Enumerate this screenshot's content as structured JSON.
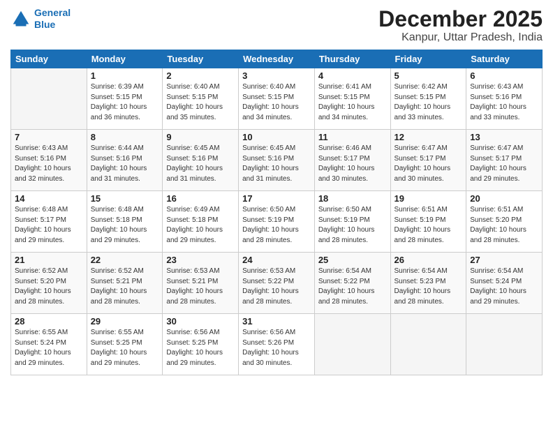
{
  "logo": {
    "line1": "General",
    "line2": "Blue"
  },
  "header": {
    "month": "December 2025",
    "location": "Kanpur, Uttar Pradesh, India"
  },
  "weekdays": [
    "Sunday",
    "Monday",
    "Tuesday",
    "Wednesday",
    "Thursday",
    "Friday",
    "Saturday"
  ],
  "weeks": [
    [
      {
        "day": "",
        "sunrise": "",
        "sunset": "",
        "daylight": ""
      },
      {
        "day": "1",
        "sunrise": "Sunrise: 6:39 AM",
        "sunset": "Sunset: 5:15 PM",
        "daylight": "Daylight: 10 hours and 36 minutes."
      },
      {
        "day": "2",
        "sunrise": "Sunrise: 6:40 AM",
        "sunset": "Sunset: 5:15 PM",
        "daylight": "Daylight: 10 hours and 35 minutes."
      },
      {
        "day": "3",
        "sunrise": "Sunrise: 6:40 AM",
        "sunset": "Sunset: 5:15 PM",
        "daylight": "Daylight: 10 hours and 34 minutes."
      },
      {
        "day": "4",
        "sunrise": "Sunrise: 6:41 AM",
        "sunset": "Sunset: 5:15 PM",
        "daylight": "Daylight: 10 hours and 34 minutes."
      },
      {
        "day": "5",
        "sunrise": "Sunrise: 6:42 AM",
        "sunset": "Sunset: 5:15 PM",
        "daylight": "Daylight: 10 hours and 33 minutes."
      },
      {
        "day": "6",
        "sunrise": "Sunrise: 6:43 AM",
        "sunset": "Sunset: 5:16 PM",
        "daylight": "Daylight: 10 hours and 33 minutes."
      }
    ],
    [
      {
        "day": "7",
        "sunrise": "Sunrise: 6:43 AM",
        "sunset": "Sunset: 5:16 PM",
        "daylight": "Daylight: 10 hours and 32 minutes."
      },
      {
        "day": "8",
        "sunrise": "Sunrise: 6:44 AM",
        "sunset": "Sunset: 5:16 PM",
        "daylight": "Daylight: 10 hours and 31 minutes."
      },
      {
        "day": "9",
        "sunrise": "Sunrise: 6:45 AM",
        "sunset": "Sunset: 5:16 PM",
        "daylight": "Daylight: 10 hours and 31 minutes."
      },
      {
        "day": "10",
        "sunrise": "Sunrise: 6:45 AM",
        "sunset": "Sunset: 5:16 PM",
        "daylight": "Daylight: 10 hours and 31 minutes."
      },
      {
        "day": "11",
        "sunrise": "Sunrise: 6:46 AM",
        "sunset": "Sunset: 5:17 PM",
        "daylight": "Daylight: 10 hours and 30 minutes."
      },
      {
        "day": "12",
        "sunrise": "Sunrise: 6:47 AM",
        "sunset": "Sunset: 5:17 PM",
        "daylight": "Daylight: 10 hours and 30 minutes."
      },
      {
        "day": "13",
        "sunrise": "Sunrise: 6:47 AM",
        "sunset": "Sunset: 5:17 PM",
        "daylight": "Daylight: 10 hours and 29 minutes."
      }
    ],
    [
      {
        "day": "14",
        "sunrise": "Sunrise: 6:48 AM",
        "sunset": "Sunset: 5:17 PM",
        "daylight": "Daylight: 10 hours and 29 minutes."
      },
      {
        "day": "15",
        "sunrise": "Sunrise: 6:48 AM",
        "sunset": "Sunset: 5:18 PM",
        "daylight": "Daylight: 10 hours and 29 minutes."
      },
      {
        "day": "16",
        "sunrise": "Sunrise: 6:49 AM",
        "sunset": "Sunset: 5:18 PM",
        "daylight": "Daylight: 10 hours and 29 minutes."
      },
      {
        "day": "17",
        "sunrise": "Sunrise: 6:50 AM",
        "sunset": "Sunset: 5:19 PM",
        "daylight": "Daylight: 10 hours and 28 minutes."
      },
      {
        "day": "18",
        "sunrise": "Sunrise: 6:50 AM",
        "sunset": "Sunset: 5:19 PM",
        "daylight": "Daylight: 10 hours and 28 minutes."
      },
      {
        "day": "19",
        "sunrise": "Sunrise: 6:51 AM",
        "sunset": "Sunset: 5:19 PM",
        "daylight": "Daylight: 10 hours and 28 minutes."
      },
      {
        "day": "20",
        "sunrise": "Sunrise: 6:51 AM",
        "sunset": "Sunset: 5:20 PM",
        "daylight": "Daylight: 10 hours and 28 minutes."
      }
    ],
    [
      {
        "day": "21",
        "sunrise": "Sunrise: 6:52 AM",
        "sunset": "Sunset: 5:20 PM",
        "daylight": "Daylight: 10 hours and 28 minutes."
      },
      {
        "day": "22",
        "sunrise": "Sunrise: 6:52 AM",
        "sunset": "Sunset: 5:21 PM",
        "daylight": "Daylight: 10 hours and 28 minutes."
      },
      {
        "day": "23",
        "sunrise": "Sunrise: 6:53 AM",
        "sunset": "Sunset: 5:21 PM",
        "daylight": "Daylight: 10 hours and 28 minutes."
      },
      {
        "day": "24",
        "sunrise": "Sunrise: 6:53 AM",
        "sunset": "Sunset: 5:22 PM",
        "daylight": "Daylight: 10 hours and 28 minutes."
      },
      {
        "day": "25",
        "sunrise": "Sunrise: 6:54 AM",
        "sunset": "Sunset: 5:22 PM",
        "daylight": "Daylight: 10 hours and 28 minutes."
      },
      {
        "day": "26",
        "sunrise": "Sunrise: 6:54 AM",
        "sunset": "Sunset: 5:23 PM",
        "daylight": "Daylight: 10 hours and 28 minutes."
      },
      {
        "day": "27",
        "sunrise": "Sunrise: 6:54 AM",
        "sunset": "Sunset: 5:24 PM",
        "daylight": "Daylight: 10 hours and 29 minutes."
      }
    ],
    [
      {
        "day": "28",
        "sunrise": "Sunrise: 6:55 AM",
        "sunset": "Sunset: 5:24 PM",
        "daylight": "Daylight: 10 hours and 29 minutes."
      },
      {
        "day": "29",
        "sunrise": "Sunrise: 6:55 AM",
        "sunset": "Sunset: 5:25 PM",
        "daylight": "Daylight: 10 hours and 29 minutes."
      },
      {
        "day": "30",
        "sunrise": "Sunrise: 6:56 AM",
        "sunset": "Sunset: 5:25 PM",
        "daylight": "Daylight: 10 hours and 29 minutes."
      },
      {
        "day": "31",
        "sunrise": "Sunrise: 6:56 AM",
        "sunset": "Sunset: 5:26 PM",
        "daylight": "Daylight: 10 hours and 30 minutes."
      },
      {
        "day": "",
        "sunrise": "",
        "sunset": "",
        "daylight": ""
      },
      {
        "day": "",
        "sunrise": "",
        "sunset": "",
        "daylight": ""
      },
      {
        "day": "",
        "sunrise": "",
        "sunset": "",
        "daylight": ""
      }
    ]
  ]
}
